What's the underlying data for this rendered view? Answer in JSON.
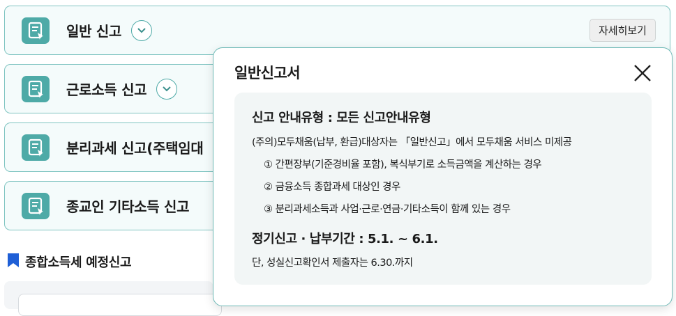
{
  "cards": [
    {
      "title": "일반 신고",
      "has_chevron": true,
      "detail_label": "자세히보기"
    },
    {
      "title": "근로소득 신고",
      "has_chevron": true
    },
    {
      "title": "분리과세 신고(주택임대",
      "has_chevron": false
    },
    {
      "title": "종교인 기타소득 신고",
      "has_chevron": false
    }
  ],
  "section": {
    "title": "종합소득세 예정신고",
    "icon": "bookmark-icon"
  },
  "popup": {
    "title": "일반신고서",
    "guide_type": "신고 안내유형 : 모든 신고안내유형",
    "notice": "(주의)모두채움(납부, 환급)대상자는 「일반신고」에서 모두채움 서비스 미제공",
    "items": [
      "① 간편장부(기준경비율 포함), 복식부기로 소득금액을 계산하는 경우",
      "② 금융소득 종합과세 대상인 경우",
      "③ 분리과세소득과 사업·근로·연금·기타소득이 함께 있는 경우"
    ],
    "period": "정기신고 · 납부기간 : 5.1. ~ 6.1.",
    "period_note": "단, 성실신고확인서 제출자는 6.30.까지"
  },
  "colors": {
    "accent": "#4eaaa7",
    "card_border": "#7fc4c1",
    "bookmark": "#1f5fd6"
  }
}
